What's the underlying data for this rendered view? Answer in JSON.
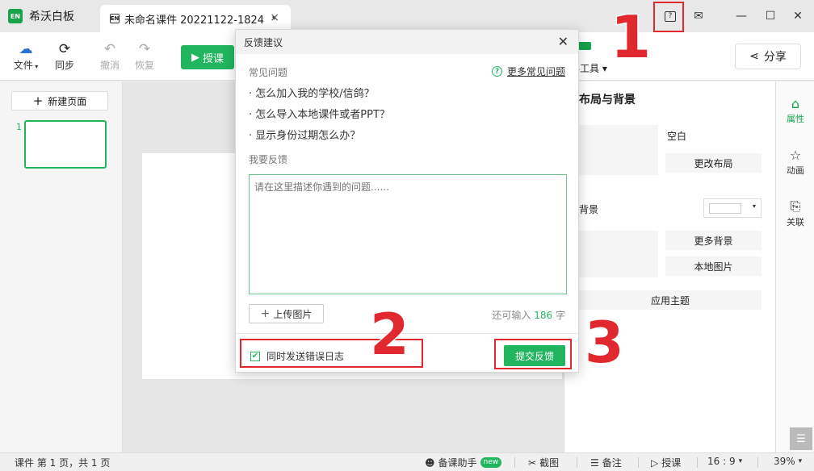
{
  "titlebar": {
    "app_name": "希沃白板",
    "app_logo_text": "EN",
    "doc_icon_text": "EN",
    "doc_tab_title": "未命名课件 20221122-1824",
    "tab_dropdown": "▾",
    "tab_close": "×",
    "feedback_icon": "?",
    "mail_icon": "✉",
    "minimize_icon": "—",
    "maximize_icon": "☐",
    "close_icon": "✕"
  },
  "annotations": {
    "n1": "1",
    "n2": "2",
    "n3": "3"
  },
  "toolbar": {
    "file_label": "文件",
    "file_icon": "☁",
    "sync_label": "同步",
    "sync_icon": "⟳",
    "undo_label": "撤消",
    "undo_icon": "↶",
    "redo_label": "恢复",
    "redo_icon": "↷",
    "teach_label": "授课",
    "teach_icon": "▶",
    "tools_label": "学科工具",
    "tools_visible": "科工具 ▾",
    "share_label": "分享",
    "share_icon": "⋖"
  },
  "left_panel": {
    "new_page_label": "新建页面",
    "new_page_icon": "+",
    "slide_number": "1"
  },
  "right_panel": {
    "title": "布局与背景",
    "blank_label": "空白",
    "change_layout": "更改布局",
    "background_label": "背景",
    "more_backgrounds": "更多背景",
    "local_image": "本地图片",
    "apply_theme": "应用主题",
    "dropdown_arrow": "▾"
  },
  "side_tabs": [
    {
      "label": "属性",
      "icon": "⌂"
    },
    {
      "label": "动画",
      "icon": "☆"
    },
    {
      "label": "关联",
      "icon": "⎘"
    }
  ],
  "statusbar": {
    "page_info": "课件 第 1 页，共 1 页",
    "assistant_label": "备课助手",
    "new_badge": "new",
    "screenshot_label": "截图",
    "screenshot_icon": "✂",
    "notes_label": "备注",
    "notes_icon": "☰",
    "teach_label": "授课",
    "teach_icon": "▷",
    "ratio_label": "16 : 9",
    "zoom_label": "39%",
    "dropdown_arrow": "▾"
  },
  "feedback_modal": {
    "title": "反馈建议",
    "close_icon": "✕",
    "faq_heading": "常见问题",
    "more_faq": "更多常见问题",
    "faq_items": [
      "· 怎么加入我的学校/信鸽？",
      "· 怎么导入本地课件或者PPT？",
      "· 显示身份过期怎么办？"
    ],
    "feedback_heading": "我要反馈",
    "placeholder": "请在这里描述你遇到的问题......",
    "upload_label": "上传图片",
    "upload_icon": "+",
    "remaining_prefix": "还可输入",
    "remaining_count": "186",
    "remaining_suffix": "字",
    "send_log_label": "同时发送错误日志",
    "send_log_checked": "✔",
    "submit_label": "提交反馈"
  }
}
